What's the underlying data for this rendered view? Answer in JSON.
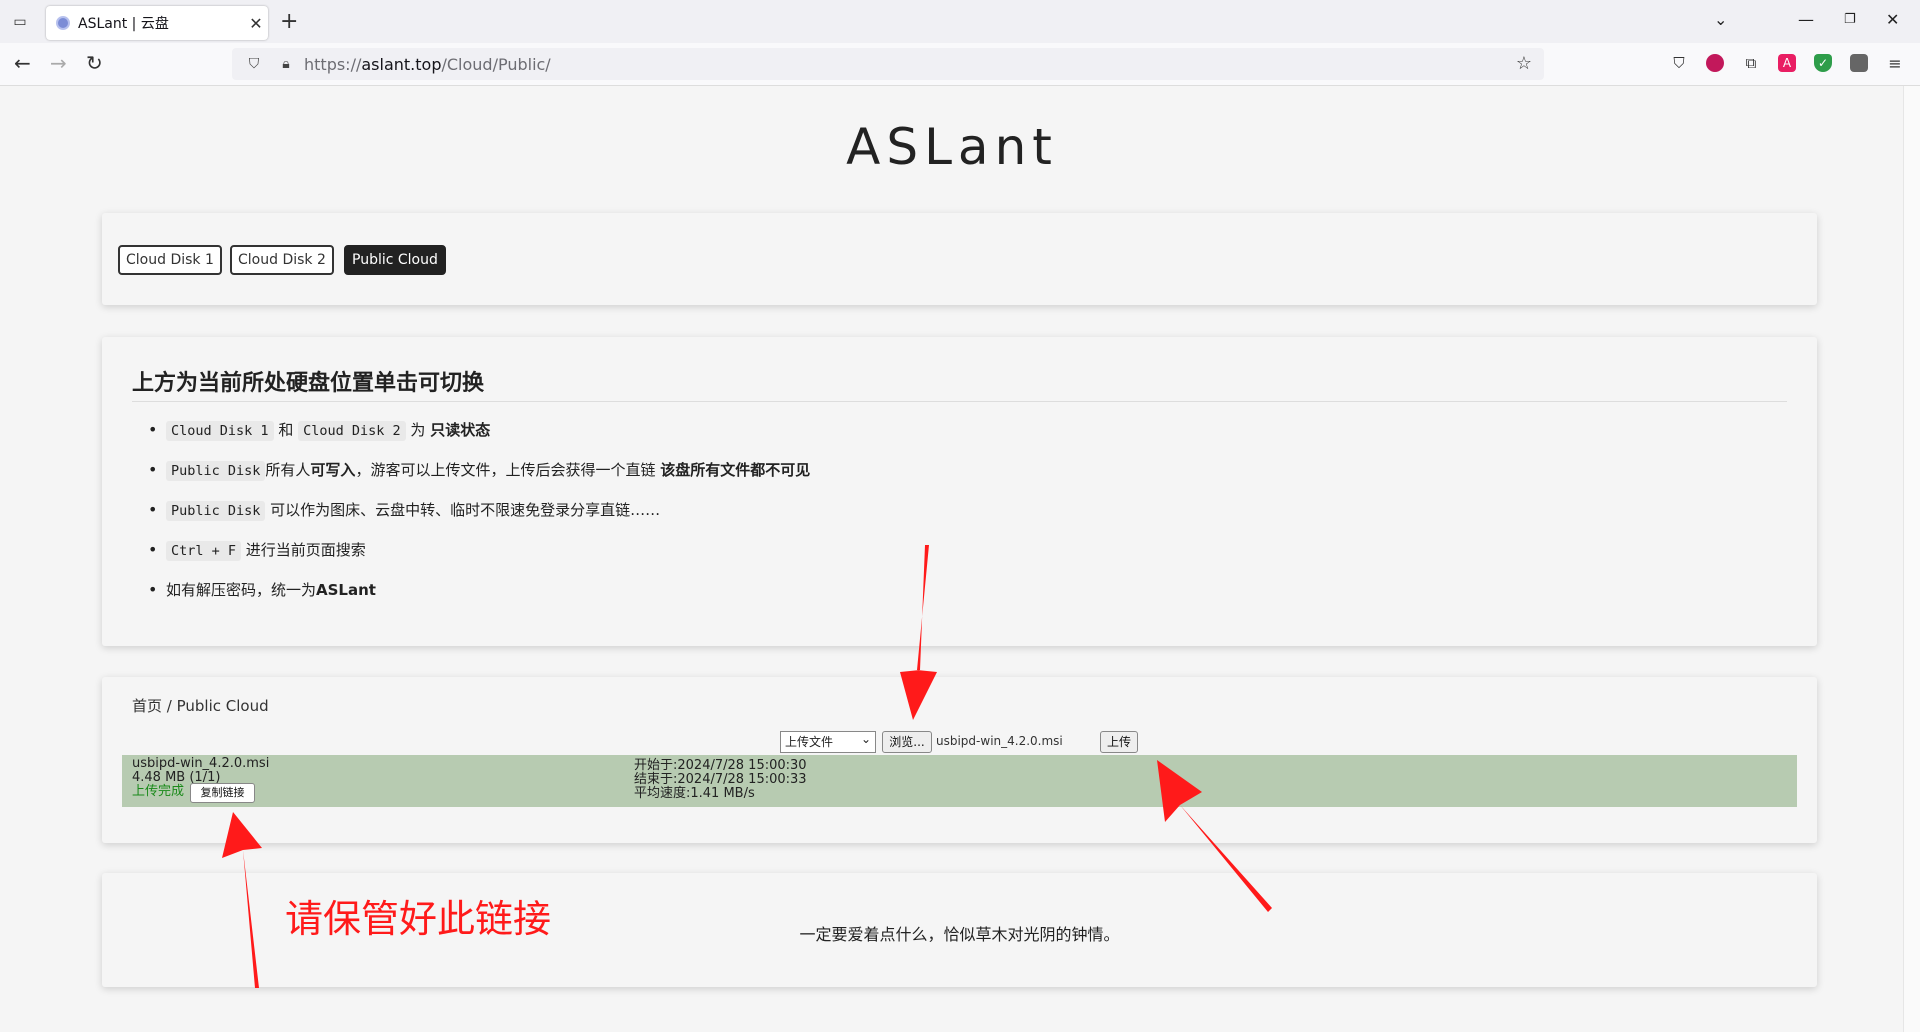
{
  "browser": {
    "tab_title": "ASLant | 云盘",
    "url_prefix": "https://",
    "url_host": "aslant.top",
    "url_path": "/Cloud/Public/"
  },
  "page": {
    "site_title": "ASLant",
    "disk_buttons": [
      "Cloud Disk 1",
      "Cloud Disk 2",
      "Public Cloud"
    ],
    "active_disk": "Public Cloud",
    "info": {
      "heading": "上方为当前所处硬盘位置单击可切换",
      "items": [
        {
          "code1": "Cloud Disk 1",
          "t1": " 和 ",
          "code2": "Cloud Disk 2",
          "t2": " 为 ",
          "bold": "只读状态"
        },
        {
          "code": "Public Disk",
          "t1": "所有人",
          "bold1": "可写入",
          "t2": "，游客可以上传文件，上传后会获得一个直链 ",
          "bold2": "该盘所有文件都不可见"
        },
        {
          "code": "Public Disk",
          "text": " 可以作为图床、云盘中转、临时不限速免登录分享直链……"
        },
        {
          "code": "Ctrl + F",
          "text": " 进行当前页面搜索"
        },
        {
          "text": "如有解压密码，统一为",
          "bold": "ASLant"
        }
      ]
    },
    "upload": {
      "breadcrumb": "首页 / Public Cloud",
      "mode_selected": "上传文件",
      "browse_label": "浏览...",
      "selected_file": "usbipd-win_4.2.0.msi",
      "upload_label": "上传",
      "result": {
        "file": "usbipd-win_4.2.0.msi",
        "size": "4.48 MB (1/1)",
        "status": "上传完成",
        "copy_label": "复制链接",
        "start": "开始于:2024/7/28 15:00:30",
        "end": "结束于:2024/7/28 15:00:33",
        "speed": "平均速度:1.41 MB/s"
      }
    },
    "quote": "一定要爱着点什么，恰似草木对光阴的钟情。"
  },
  "annotation": {
    "text": "请保管好此链接",
    "color": "#ff1a1a"
  }
}
